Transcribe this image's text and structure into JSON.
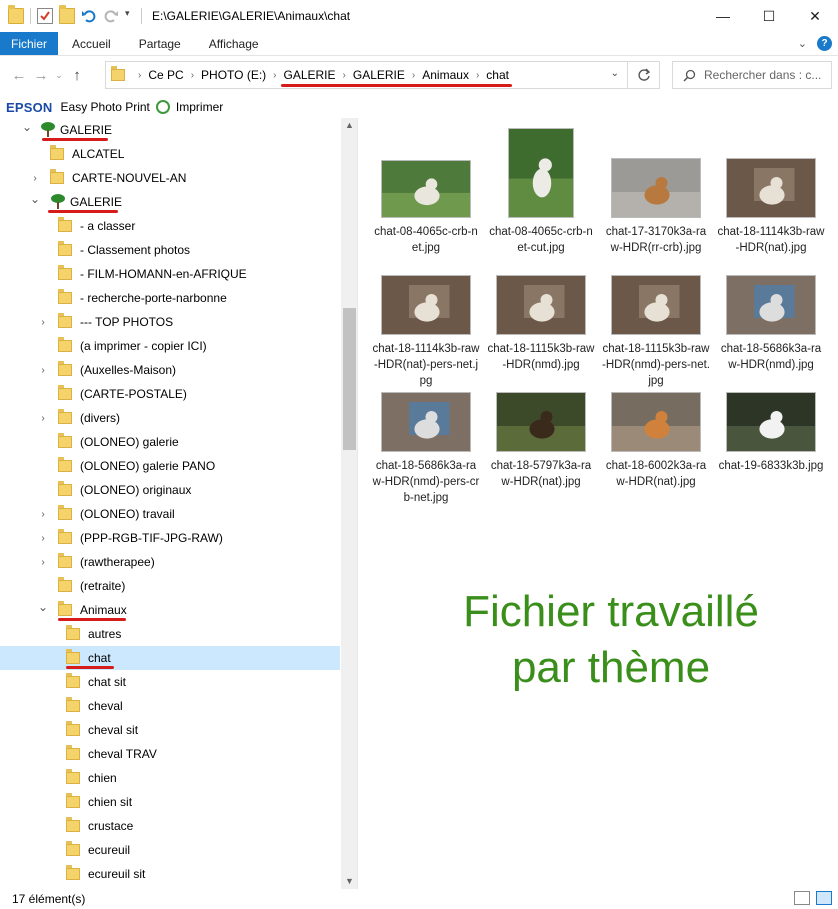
{
  "title_bar": {
    "path": "E:\\GALERIE\\GALERIE\\Animaux\\chat"
  },
  "window_controls": {
    "minimize": "—",
    "maximize": "☐",
    "close": "✕"
  },
  "ribbon": {
    "tabs": [
      "Fichier",
      "Accueil",
      "Partage",
      "Affichage"
    ]
  },
  "address": {
    "crumbs": [
      "Ce PC",
      "PHOTO (E:)",
      "GALERIE",
      "GALERIE",
      "Animaux",
      "chat"
    ]
  },
  "search": {
    "placeholder": "Rechercher dans : c..."
  },
  "epson": {
    "brand": "EPSON",
    "easy_print": "Easy Photo Print",
    "print": "Imprimer"
  },
  "tree": [
    {
      "label": "GALERIE",
      "level": 0,
      "icon": "network-tree",
      "expanded": true
    },
    {
      "label": "ALCATEL",
      "level": 1
    },
    {
      "label": "CARTE-NOUVEL-AN",
      "level": 1,
      "has_children": true
    },
    {
      "label": "GALERIE",
      "level": 1,
      "icon": "network-tree",
      "expanded": true
    },
    {
      "label": "- a classer",
      "level": 2
    },
    {
      "label": "- Classement photos",
      "level": 2
    },
    {
      "label": "- FILM-HOMANN-en-AFRIQUE",
      "level": 2
    },
    {
      "label": "- recherche-porte-narbonne",
      "level": 2
    },
    {
      "label": "--- TOP PHOTOS",
      "level": 2,
      "has_children": true
    },
    {
      "label": "(a imprimer - copier ICI)",
      "level": 2
    },
    {
      "label": "(Auxelles-Maison)",
      "level": 2,
      "has_children": true
    },
    {
      "label": "(CARTE-POSTALE)",
      "level": 2
    },
    {
      "label": "(divers)",
      "level": 2,
      "has_children": true
    },
    {
      "label": "(OLONEO) galerie",
      "level": 2
    },
    {
      "label": "(OLONEO) galerie PANO",
      "level": 2
    },
    {
      "label": "(OLONEO) originaux",
      "level": 2
    },
    {
      "label": "(OLONEO) travail",
      "level": 2,
      "has_children": true
    },
    {
      "label": "(PPP-RGB-TIF-JPG-RAW)",
      "level": 2,
      "has_children": true
    },
    {
      "label": "(rawtherapee)",
      "level": 2,
      "has_children": true
    },
    {
      "label": "(retraite)",
      "level": 2
    },
    {
      "label": "Animaux",
      "level": 2,
      "expanded": true
    },
    {
      "label": "autres",
      "level": 3
    },
    {
      "label": "chat",
      "level": 3,
      "selected": true
    },
    {
      "label": "chat sit",
      "level": 3
    },
    {
      "label": "cheval",
      "level": 3
    },
    {
      "label": "cheval sit",
      "level": 3
    },
    {
      "label": "cheval TRAV",
      "level": 3
    },
    {
      "label": "chien",
      "level": 3
    },
    {
      "label": "chien sit",
      "level": 3
    },
    {
      "label": "crustace",
      "level": 3
    },
    {
      "label": "ecureuil",
      "level": 3
    },
    {
      "label": "ecureuil sit",
      "level": 3
    }
  ],
  "files": [
    {
      "name": "chat-08-4065c-crb-net.jpg",
      "thumb": "grass-cat"
    },
    {
      "name": "chat-08-4065c-crb-net-cut.jpg",
      "thumb": "grass-cat-portrait"
    },
    {
      "name": "chat-17-3170k3a-raw-HDR(rr-crb).jpg",
      "thumb": "road-cat"
    },
    {
      "name": "chat-18-1114k3b-raw-HDR(nat).jpg",
      "thumb": "window-cat"
    },
    {
      "name": "chat-18-1114k3b-raw-HDR(nat)-pers-net.jpg",
      "thumb": "window-cat"
    },
    {
      "name": "chat-18-1115k3b-raw-HDR(nmd).jpg",
      "thumb": "window-cat"
    },
    {
      "name": "chat-18-1115k3b-raw-HDR(nmd)-pers-net.jpg",
      "thumb": "window-cat"
    },
    {
      "name": "chat-18-5686k3a-raw-HDR(nmd).jpg",
      "thumb": "blue-window"
    },
    {
      "name": "chat-18-5686k3a-raw-HDR(nmd)-pers-crb-net.jpg",
      "thumb": "blue-window"
    },
    {
      "name": "chat-18-5797k3a-raw-HDR(nat).jpg",
      "thumb": "tortie-cat"
    },
    {
      "name": "chat-18-6002k3a-raw-HDR(nat).jpg",
      "thumb": "orange-cat"
    },
    {
      "name": "chat-19-6833k3b.jpg",
      "thumb": "dark-cat"
    }
  ],
  "overlay": {
    "line1": "Fichier travaillé",
    "line2": "par thème"
  },
  "status": {
    "count": "17 élément(s)"
  },
  "colors": {
    "accent": "#1979ca",
    "annotation": "#d61b1b",
    "overlay_text": "#3a8f1a"
  }
}
